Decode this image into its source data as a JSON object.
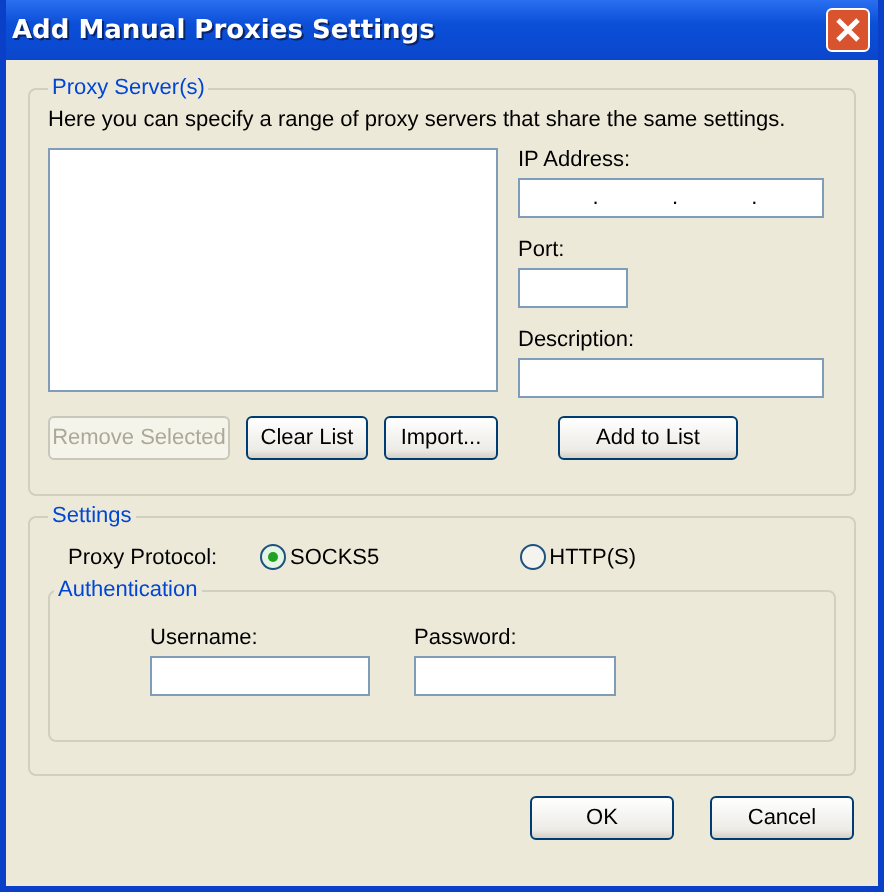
{
  "window": {
    "title": "Add Manual Proxies Settings"
  },
  "proxy_servers": {
    "title": "Proxy Server(s)",
    "description": "Here you can specify a range of proxy servers that share the same settings.",
    "ip_address": {
      "label": "IP Address:",
      "separators": [
        ".",
        ".",
        "."
      ]
    },
    "port": {
      "label": "Port:"
    },
    "description_field": {
      "label": "Description:"
    },
    "buttons": [
      {
        "label": "Remove Selected",
        "disabled": true
      },
      {
        "label": "Clear List",
        "disabled": false
      },
      {
        "label": "Import...",
        "disabled": false
      }
    ],
    "add_button": {
      "label": "Add to List"
    }
  },
  "settings": {
    "title": "Settings",
    "protocol_label": "Proxy Protocol:",
    "protocols": [
      {
        "label": "SOCKS5",
        "selected": true
      },
      {
        "label": "HTTP(S)",
        "selected": false
      }
    ],
    "authentication": {
      "title": "Authentication",
      "username": {
        "label": "Username:"
      },
      "password": {
        "label": "Password:"
      }
    }
  },
  "footer_buttons": [
    "OK",
    "Cancel"
  ]
}
